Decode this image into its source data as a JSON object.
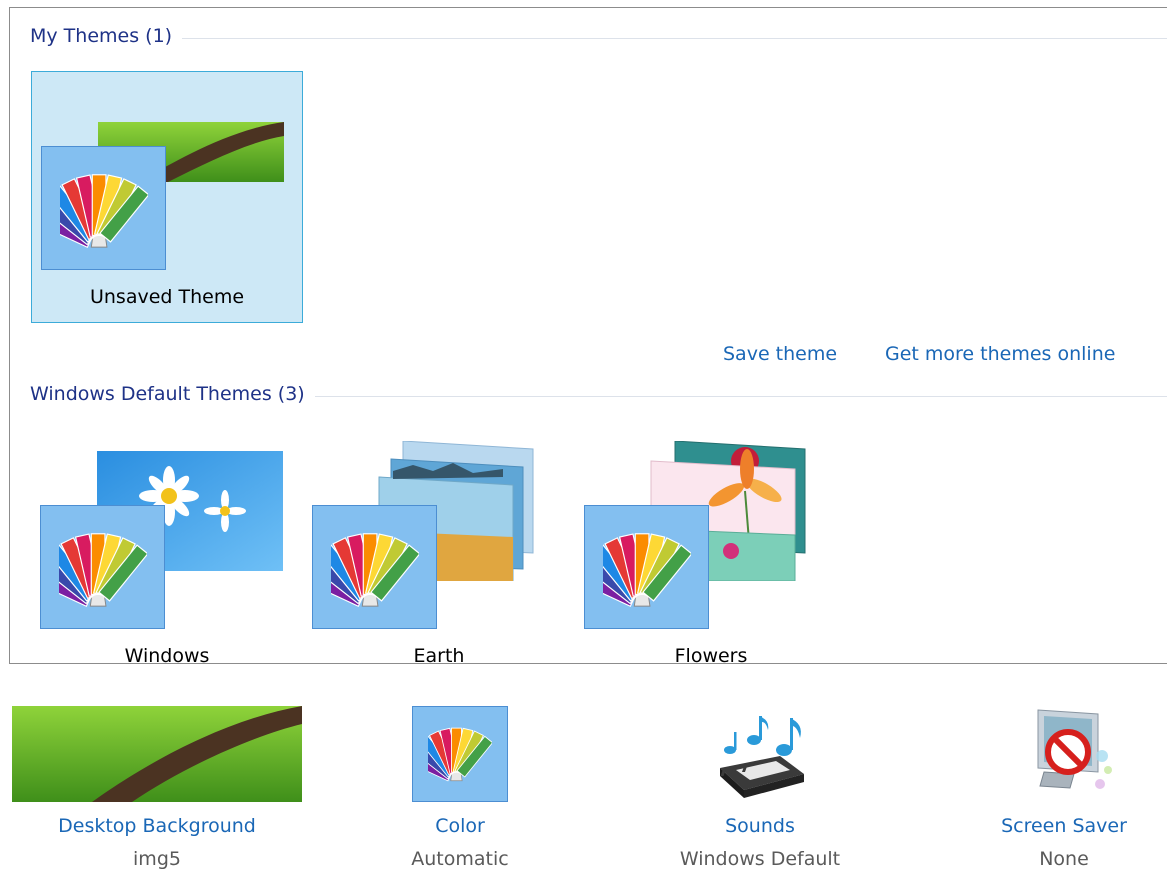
{
  "my_themes": {
    "header": "My Themes (1)",
    "items": [
      {
        "label": "Unsaved Theme",
        "selected": true
      }
    ]
  },
  "links": {
    "save_theme": "Save theme",
    "get_more": "Get more themes online"
  },
  "default_themes": {
    "header": "Windows Default Themes (3)",
    "items": [
      {
        "label": "Windows"
      },
      {
        "label": "Earth"
      },
      {
        "label": "Flowers"
      }
    ]
  },
  "bottom_bar": [
    {
      "label": "Desktop Background",
      "value": "img5",
      "icon": "desktop-background-thumbnail"
    },
    {
      "label": "Color",
      "value": "Automatic",
      "icon": "color-palette-icon"
    },
    {
      "label": "Sounds",
      "value": "Windows Default",
      "icon": "music-keyboard-icon"
    },
    {
      "label": "Screen Saver",
      "value": "None",
      "icon": "screen-saver-icon"
    }
  ],
  "colors": {
    "header_text": "#1e3287",
    "link": "#1a67b6",
    "selection_fill": "#cde8f6",
    "selection_border": "#3cabd9",
    "color_tile": "#83bff0"
  }
}
